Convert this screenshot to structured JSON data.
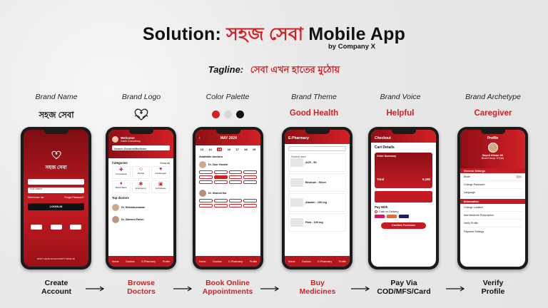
{
  "title": {
    "prefix": "Solution:",
    "brand": "সহজ সেবা",
    "suffix": "Mobile App"
  },
  "byline": "by Company X",
  "tagline": {
    "label": "Tagline:",
    "text": "সেবা এখন হাতের মুঠোয়"
  },
  "columns": [
    {
      "head": "Brand Name",
      "value": "সহজ সেবা",
      "bottom1": "Create",
      "bottom2": "Account"
    },
    {
      "head": "Brand Logo",
      "bottom1": "Browse",
      "bottom2": "Doctors"
    },
    {
      "head": "Color Palette",
      "bottom1": "Book Online",
      "bottom2": "Appointments"
    },
    {
      "head": "Brand Theme",
      "value": "Good Health",
      "bottom1": "Buy",
      "bottom2": "Medicines"
    },
    {
      "head": "Brand Voice",
      "value": "Helpful",
      "bottom1": "Pay Via",
      "bottom2": "COD/MFS/Card"
    },
    {
      "head": "Brand Archetype",
      "value": "Caregiver",
      "bottom1": "Verify",
      "bottom2": "Profile"
    }
  ],
  "colors": {
    "brand_red": "#d32027",
    "dark_red": "#8e0f15",
    "palette": [
      "#d32027",
      "#d9d9d9",
      "#111111"
    ]
  },
  "nav": {
    "home": "Home",
    "doctors": "Doctors",
    "epharmacy": "E-Pharmacy",
    "profile": "Profile"
  },
  "screen1": {
    "brand": "সহজ সেবা",
    "name_placeholder": "Full Name",
    "password_placeholder": "Password",
    "remember": "Remember me",
    "forgot": "Forgot Password?",
    "login": "LOGIN IN",
    "signup": "DON'T HAVE AN ACCOUNT? SIGN UP"
  },
  "screen2": {
    "welcome": "Welcome",
    "user": "Kabib Chowdhury",
    "search": "Search Doctors/Medicine",
    "categories": "Categories",
    "show_all": "Show All",
    "cats": [
      "Consultation",
      "Dentist",
      "Cardiologist",
      "Blood Bank",
      "Emergency",
      "Ambulance"
    ],
    "top_doctors": "Top doctors",
    "doctors": [
      "Dr. Shibbiruzzaman",
      "Dr. Zaheera Parvin"
    ]
  },
  "screen3": {
    "month": "MAY 2024",
    "days": [
      "13",
      "14",
      "15",
      "16",
      "17",
      "18",
      "19"
    ],
    "available": "Available doctors",
    "doc1": "Dr. Zaur Yasmin",
    "doc2": "Dr. Shahed Kai"
  },
  "screen4": {
    "header": "E-Pharmacy",
    "search": "Search here",
    "meds": [
      "ACE - 50",
      "Bextrum - Silver",
      "Alaskin - 100 mg",
      "Para - 100 mg"
    ]
  },
  "screen5": {
    "header": "Checkout",
    "cart": "Cart Details",
    "summary": "Order Summary",
    "total": "Total",
    "total_value": "5,180",
    "pay_with": "Pay With",
    "cod": "Cash on Delivery",
    "confirm": "Confirm Purchase"
  },
  "screen6": {
    "header": "Profile",
    "name": "Sayed Ahsan Ali",
    "blood": "Blood Group: O+(ve)",
    "general": "General Settings",
    "items": [
      "Mode",
      "Change Password",
      "Language"
    ],
    "information": "Information",
    "info_items": [
      "Change Location",
      "Add Medicine Prescription",
      "Verify Profile",
      "Payment Settings"
    ]
  }
}
